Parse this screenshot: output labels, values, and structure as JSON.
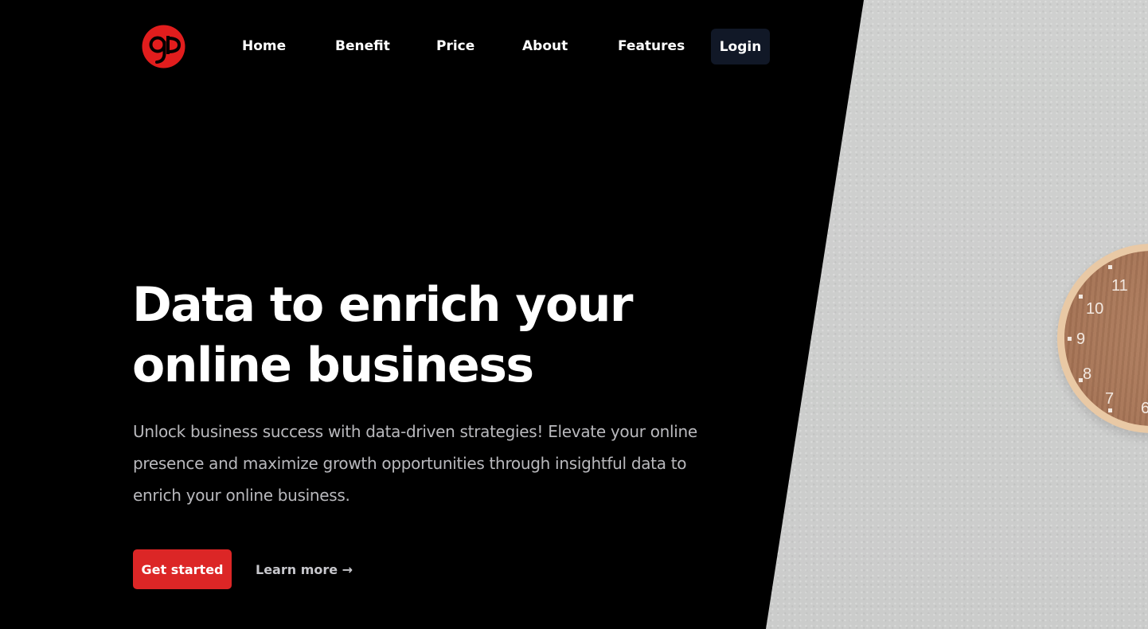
{
  "brand": {
    "logo_icon": "qp-monogram-logo",
    "accent_color": "#dc2626"
  },
  "nav": {
    "items": [
      {
        "label": "Home"
      },
      {
        "label": "Benefit"
      },
      {
        "label": "Price"
      },
      {
        "label": "About"
      },
      {
        "label": "Features"
      }
    ],
    "login_label": "Login"
  },
  "hero": {
    "title_line1": "Data to enrich your",
    "title_line2": "online business",
    "description": "Unlock business success with data-driven strategies! Elevate your online presence and maximize growth opportunities through insightful data to enrich your online business.",
    "primary_cta": "Get started",
    "secondary_cta": "Learn more →"
  },
  "photo": {
    "subject": "wall-clock-icon",
    "clock_numerals": [
      "11",
      "10",
      "9",
      "8",
      "7",
      "6"
    ]
  }
}
